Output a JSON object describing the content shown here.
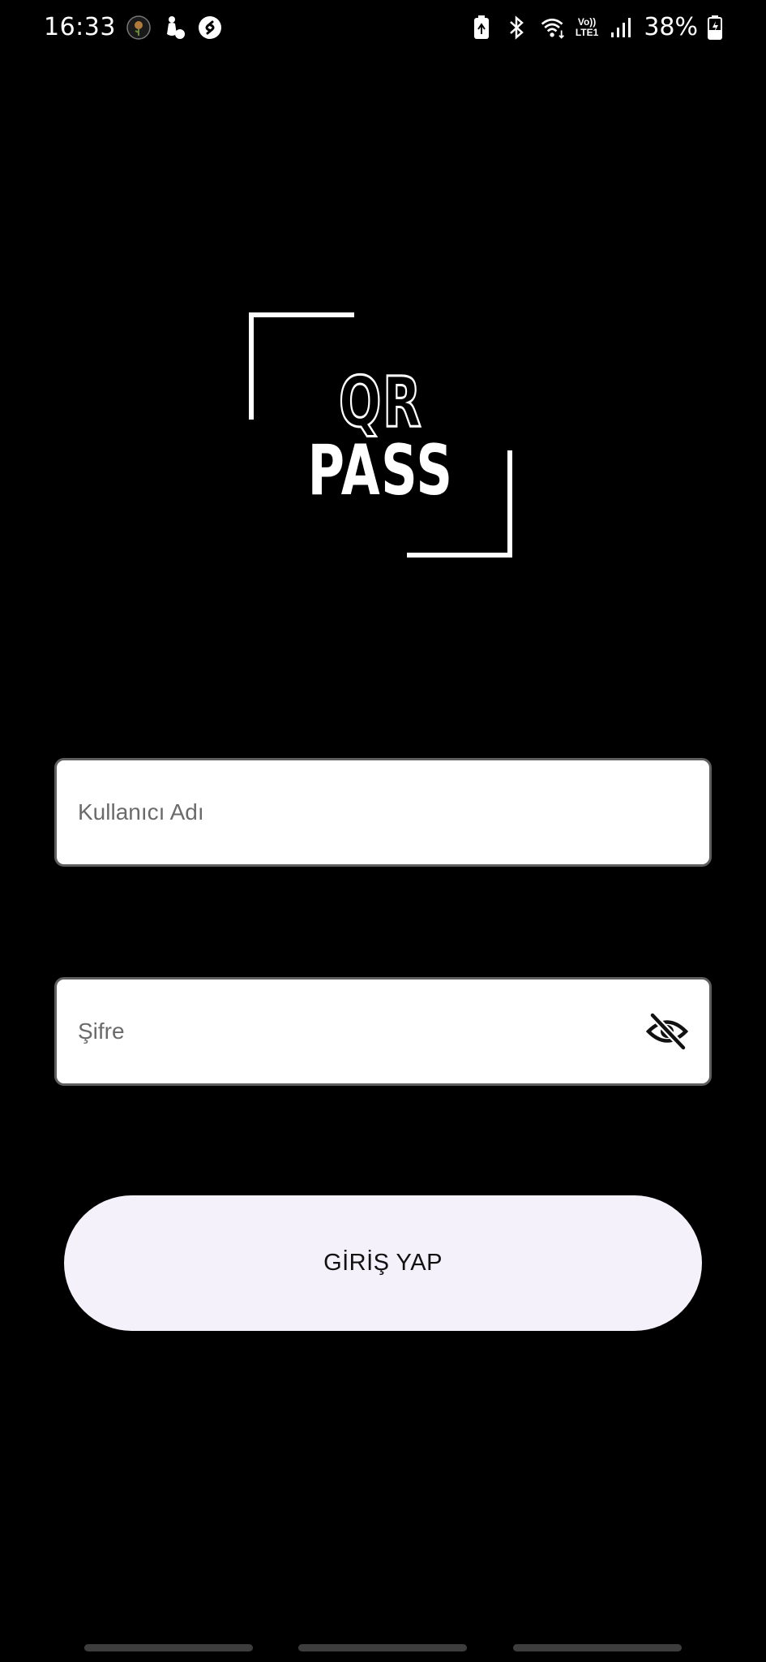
{
  "status_bar": {
    "time": "16:33",
    "notification_icons": [
      "rose-icon",
      "bowling-icon",
      "shazam-icon"
    ],
    "system_icons": [
      "battery-saver-icon",
      "bluetooth-icon",
      "wifi-icon",
      "volte-icon",
      "signal-icon"
    ],
    "volte_label": "Vo))",
    "lte_label": "LTE1",
    "battery_percent": "38%"
  },
  "logo": {
    "line1": "QR",
    "line2": "PASS"
  },
  "login_form": {
    "username": {
      "placeholder": "Kullanıcı Adı",
      "value": ""
    },
    "password": {
      "placeholder": "Şifre",
      "value": "",
      "visibility_icon": "eye-off-icon"
    },
    "submit_label": "GİRİŞ YAP"
  },
  "colors": {
    "background": "#000000",
    "field_background": "#ffffff",
    "field_border": "#5f5f5f",
    "button_background": "#f4f1fa",
    "text_primary": "#111111",
    "placeholder": "#6b6b6b"
  }
}
